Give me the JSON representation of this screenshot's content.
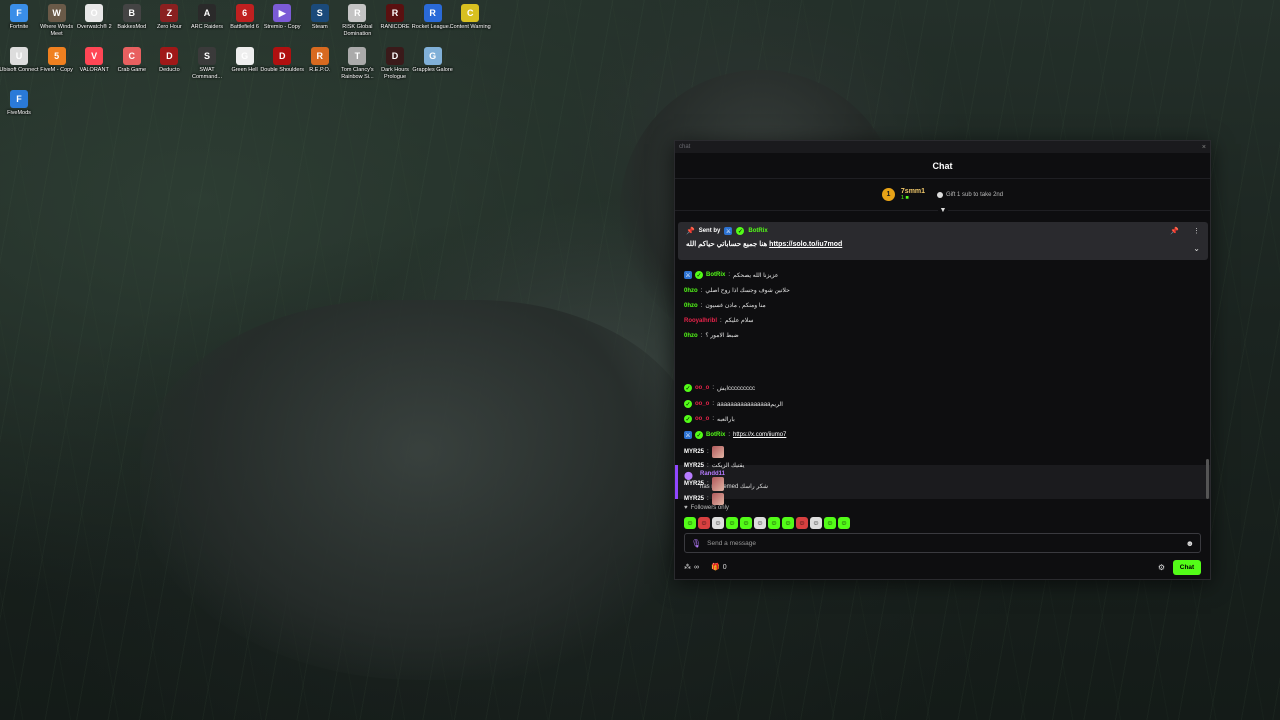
{
  "desktop": {
    "icons": [
      {
        "label": "Fortnite",
        "color": "#3a8ee8",
        "glyph": "F"
      },
      {
        "label": "Where Winds Meet",
        "color": "#6a5a48",
        "glyph": "W"
      },
      {
        "label": "Overwatch® 2",
        "color": "#e8e8e8",
        "glyph": "O"
      },
      {
        "label": "BakkesMod",
        "color": "#444",
        "glyph": "B"
      },
      {
        "label": "Zero Hour",
        "color": "#8a2020",
        "glyph": "Z"
      },
      {
        "label": "ARC Raiders",
        "color": "#2a2a2a",
        "glyph": "A"
      },
      {
        "label": "Battlefield 6",
        "color": "#c02020",
        "glyph": "6"
      },
      {
        "label": "Stremio - Copy",
        "color": "#7b5bd6",
        "glyph": "▶"
      },
      {
        "label": "Steam",
        "color": "#1b4a7a",
        "glyph": "S"
      },
      {
        "label": "RISK Global Domination",
        "color": "#c4c4c4",
        "glyph": "R"
      },
      {
        "label": "RANICORE",
        "color": "#5a1010",
        "glyph": "R"
      },
      {
        "label": "Rocket League...",
        "color": "#2a6ad8",
        "glyph": "R"
      },
      {
        "label": "Content Warning",
        "color": "#d8c020",
        "glyph": "C"
      },
      {
        "label": "Ubisoft Connect",
        "color": "#ddd",
        "glyph": "U"
      },
      {
        "label": "FiveM - Copy",
        "color": "#f08020",
        "glyph": "5"
      },
      {
        "label": "VALORANT",
        "color": "#ff4655",
        "glyph": "V"
      },
      {
        "label": "Crab Game",
        "color": "#e86060",
        "glyph": "C"
      },
      {
        "label": "Deducto",
        "color": "#a01818",
        "glyph": "D"
      },
      {
        "label": "SWAT Command...",
        "color": "#3a3a3a",
        "glyph": "S"
      },
      {
        "label": "Green Hell",
        "color": "#eee",
        "glyph": "G"
      },
      {
        "label": "Double Shoulders",
        "color": "#b01010",
        "glyph": "D"
      },
      {
        "label": "R.E.P.O.",
        "color": "#d86a20",
        "glyph": "R"
      },
      {
        "label": "Tom Clancy's Rainbow Si...",
        "color": "#aaa",
        "glyph": "T"
      },
      {
        "label": "Dark Hours Prologue",
        "color": "#3a1a1a",
        "glyph": "D"
      },
      {
        "label": "Grapples Galore",
        "color": "#80b0d8",
        "glyph": "G"
      },
      {
        "label": "FiveMods",
        "color": "#2a7ad8",
        "glyph": "F"
      }
    ]
  },
  "window": {
    "title": "chat",
    "close": "×"
  },
  "chat": {
    "header": "Chat",
    "top_gifter": {
      "rank": "1",
      "name": "7smm1",
      "count": "1"
    },
    "gift_hint": "Gift 1 sub to take 2nd",
    "pinned": {
      "sent_by": "Sent by",
      "author": "BotRix",
      "text": "هنا جميع حساباتي حياكم الله ",
      "link": "https://solo.to/iu7mod"
    },
    "messages": [
      {
        "user": "BotRix",
        "color": "#53fc18",
        "badges": [
          "bot",
          "verified"
        ],
        "text": "عزيزنا الله يصحكم"
      },
      {
        "user": "0hzo",
        "color": "#53fc18",
        "badges": [],
        "text": "حلاتين شوف وجسك اذا روح اصلي"
      },
      {
        "user": "0hzo",
        "color": "#53fc18",
        "badges": [],
        "text": "منا ومنكم , مادن غسيون"
      },
      {
        "user": "Rooyalhribl",
        "color": "#e8234a",
        "badges": [],
        "text": "سلام عليكم"
      },
      {
        "user": "0hzo",
        "color": "#53fc18",
        "badges": [],
        "text": "ضبط الامور ؟"
      },
      {
        "user": "oo_o",
        "color": "#e8234a",
        "badges": [
          "verified"
        ],
        "text": "ايشccccccccc"
      },
      {
        "user": "oo_o",
        "color": "#e8234a",
        "badges": [
          "verified"
        ],
        "text": "aaaaaaaaaaaaaaaaالريم"
      },
      {
        "user": "oo_o",
        "color": "#e8234a",
        "badges": [
          "verified"
        ],
        "text": "بارالعبه"
      },
      {
        "user": "BotRix",
        "color": "#53fc18",
        "badges": [
          "bot",
          "verified"
        ],
        "link": "https://x.com/iiumo7"
      },
      {
        "user": "MYR25",
        "color": "#ffffff",
        "badges": [],
        "emote": true
      },
      {
        "user": "MYR25",
        "color": "#ffffff",
        "badges": [],
        "text": "يقتيك الزيكت"
      },
      {
        "user": "MYR25",
        "color": "#ffffff",
        "badges": [],
        "emote": true
      },
      {
        "user": "MYR25",
        "color": "#ffffff",
        "badges": [],
        "emote": true
      }
    ],
    "redeem": {
      "user": "Randd11",
      "action": "has redeemed",
      "reward": "شكر راسك"
    },
    "followers_only": "Followers only",
    "emote_bar_colors": [
      "#53fc18",
      "#d84040",
      "#ddd",
      "#53fc18",
      "#53fc18",
      "#ddd",
      "#53fc18",
      "#53fc18",
      "#d84040",
      "#ddd",
      "#53fc18",
      "#53fc18"
    ],
    "input_placeholder": "Send a message",
    "infinity": "∞",
    "gift_count": "0",
    "chat_button": "Chat"
  }
}
